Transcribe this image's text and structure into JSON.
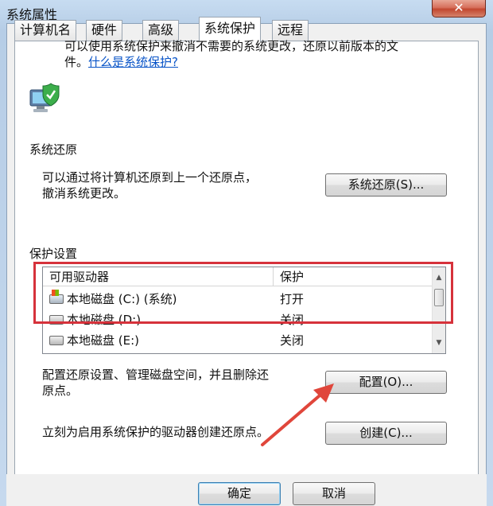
{
  "window": {
    "title": "系统属性",
    "close_glyph": "✕"
  },
  "tabs": [
    {
      "label": "计算机名",
      "active": false
    },
    {
      "label": "硬件",
      "active": false
    },
    {
      "label": "高级",
      "active": false
    },
    {
      "label": "系统保护",
      "active": true
    },
    {
      "label": "远程",
      "active": false
    }
  ],
  "intro": {
    "text": "可以使用系统保护来撤消不需要的系统更改，还原以前版本的文件。",
    "link": "什么是系统保护?"
  },
  "restore": {
    "group_label": "系统还原",
    "description_line1": "可以通过将计算机还原到上一个还原点，",
    "description_line2": "撤消系统更改。",
    "button": "系统还原(S)..."
  },
  "protection": {
    "group_label": "保护设置",
    "columns": {
      "drive": "可用驱动器",
      "protection": "保护"
    },
    "rows": [
      {
        "name": "本地磁盘 (C:) (系统)",
        "state": "打开",
        "system": true
      },
      {
        "name": "本地磁盘 (D:)",
        "state": "关闭",
        "system": false
      },
      {
        "name": "本地磁盘 (E:)",
        "state": "关闭",
        "system": false
      }
    ],
    "config_description_line1": "配置还原设置、管理磁盘空间，并且删除还",
    "config_description_line2": "原点。",
    "config_button": "配置(O)...",
    "create_description": "立刻为启用系统保护的驱动器创建还原点。",
    "create_button": "创建(C)..."
  },
  "footer": {
    "ok": "确定",
    "cancel": "取消"
  },
  "colors": {
    "highlight": "#d6323b",
    "arrow": "#e0463b",
    "link": "#0a55c8"
  }
}
